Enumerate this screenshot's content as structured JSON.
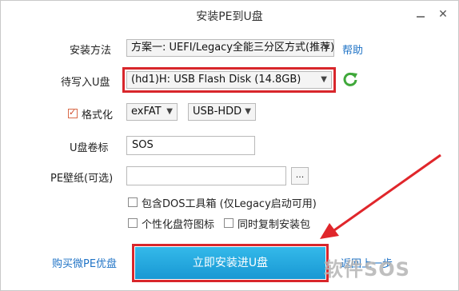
{
  "window": {
    "title": "安装PE到U盘",
    "close_label": "✕"
  },
  "install_method": {
    "label": "安装方法",
    "value": "方案一: UEFI/Legacy全能三分区方式(推荐)",
    "help_link": "帮助"
  },
  "target_disk": {
    "label": "待写入U盘",
    "value": "(hd1)H: USB Flash Disk (14.8GB)"
  },
  "format": {
    "label": "格式化",
    "checked": true,
    "filesystem": "exFAT",
    "mode": "USB-HDD"
  },
  "volume": {
    "label": "U盘卷标",
    "value": "SOS"
  },
  "wallpaper": {
    "label": "PE壁纸(可选)",
    "value": "",
    "browse_label": "..."
  },
  "options": [
    {
      "label": "包含DOS工具箱 (仅Legacy启动可用)",
      "checked": false
    },
    {
      "label": "个性化盘符图标",
      "checked": false
    },
    {
      "label": "同时复制安装包",
      "checked": false
    }
  ],
  "footer": {
    "buy_link": "购买微PE优盘",
    "install_button": "立即安装进U盘",
    "back_link": "返回上一步"
  },
  "watermark": "软件SOS",
  "colors": {
    "highlight": "#d8262b",
    "primary": "#1898d3",
    "link": "#1f73c6"
  }
}
